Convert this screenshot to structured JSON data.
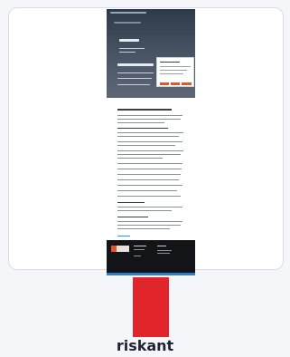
{
  "label": "riskant",
  "swatch_color": "#e0262a",
  "accent_color": "#e3542b",
  "footer_color": "#121417"
}
